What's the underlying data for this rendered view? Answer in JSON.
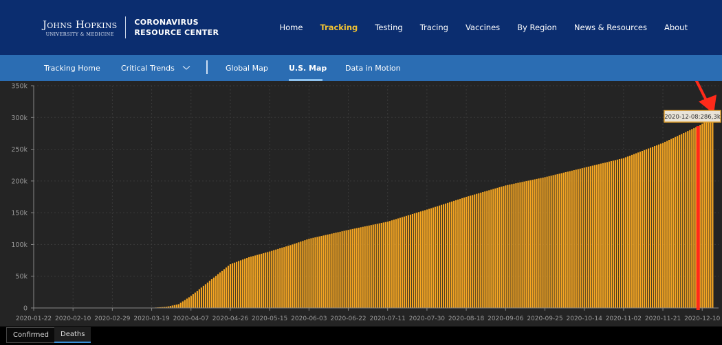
{
  "header": {
    "logo_line1": "Johns Hopkins",
    "logo_line2": "UNIVERSITY & MEDICINE",
    "title_line1": "CORONAVIRUS",
    "title_line2": "RESOURCE CENTER",
    "nav": [
      {
        "label": "Home"
      },
      {
        "label": "Tracking",
        "active": true
      },
      {
        "label": "Testing"
      },
      {
        "label": "Tracing"
      },
      {
        "label": "Vaccines"
      },
      {
        "label": "By Region"
      },
      {
        "label": "News & Resources"
      },
      {
        "label": "About"
      }
    ]
  },
  "subnav": {
    "items": [
      {
        "label": "Tracking Home"
      },
      {
        "label": "Critical Trends"
      },
      {
        "label": "Global Map"
      },
      {
        "label": "U.S. Map",
        "active": true
      },
      {
        "label": "Data in Motion"
      }
    ]
  },
  "tabs": [
    {
      "label": "Confirmed"
    },
    {
      "label": "Deaths",
      "active": true
    }
  ],
  "colors": {
    "nav_bg": "#0b2d6f",
    "subnav_bg": "#2b6db3",
    "accent": "#f1c232",
    "bar": "#f5a623",
    "chart_bg": "#242424",
    "highlight": "#ff2a1a"
  },
  "chart_data": {
    "type": "bar",
    "xlabel": "",
    "ylabel": "",
    "x_range": [
      "2020-01-22",
      "2020-12-15"
    ],
    "ylim": [
      0,
      350000
    ],
    "y_ticks": [
      "0",
      "50k",
      "100k",
      "150k",
      "200k",
      "250k",
      "300k",
      "350k"
    ],
    "x_ticks": [
      "2020-01-22",
      "2020-02-10",
      "2020-02-29",
      "2020-03-19",
      "2020-04-07",
      "2020-04-26",
      "2020-05-15",
      "2020-06-03",
      "2020-06-22",
      "2020-07-11",
      "2020-07-30",
      "2020-08-18",
      "2020-09-06",
      "2020-09-25",
      "2020-10-14",
      "2020-11-02",
      "2020-11-21",
      "2020-12-10"
    ],
    "grid": true,
    "daily_cumulative_samples": [
      [
        "2020-01-22",
        0
      ],
      [
        "2020-03-10",
        30
      ],
      [
        "2020-03-19",
        300
      ],
      [
        "2020-03-26",
        1800
      ],
      [
        "2020-04-01",
        6000
      ],
      [
        "2020-04-07",
        19000
      ],
      [
        "2020-04-15",
        40000
      ],
      [
        "2020-04-26",
        69000
      ],
      [
        "2020-05-05",
        80000
      ],
      [
        "2020-05-15",
        89000
      ],
      [
        "2020-05-26",
        100000
      ],
      [
        "2020-06-03",
        109000
      ],
      [
        "2020-06-22",
        123000
      ],
      [
        "2020-07-11",
        136000
      ],
      [
        "2020-07-30",
        155000
      ],
      [
        "2020-08-18",
        175000
      ],
      [
        "2020-09-06",
        193000
      ],
      [
        "2020-09-25",
        206000
      ],
      [
        "2020-10-14",
        221000
      ],
      [
        "2020-11-02",
        236000
      ],
      [
        "2020-11-21",
        260000
      ],
      [
        "2020-12-08",
        286300
      ],
      [
        "2020-12-15",
        300000
      ]
    ],
    "tooltip": {
      "date": "2020-12-08",
      "value": "286,3k",
      "label": "2020-12-08:286,3k"
    },
    "highlighted_date": "2020-12-08"
  }
}
